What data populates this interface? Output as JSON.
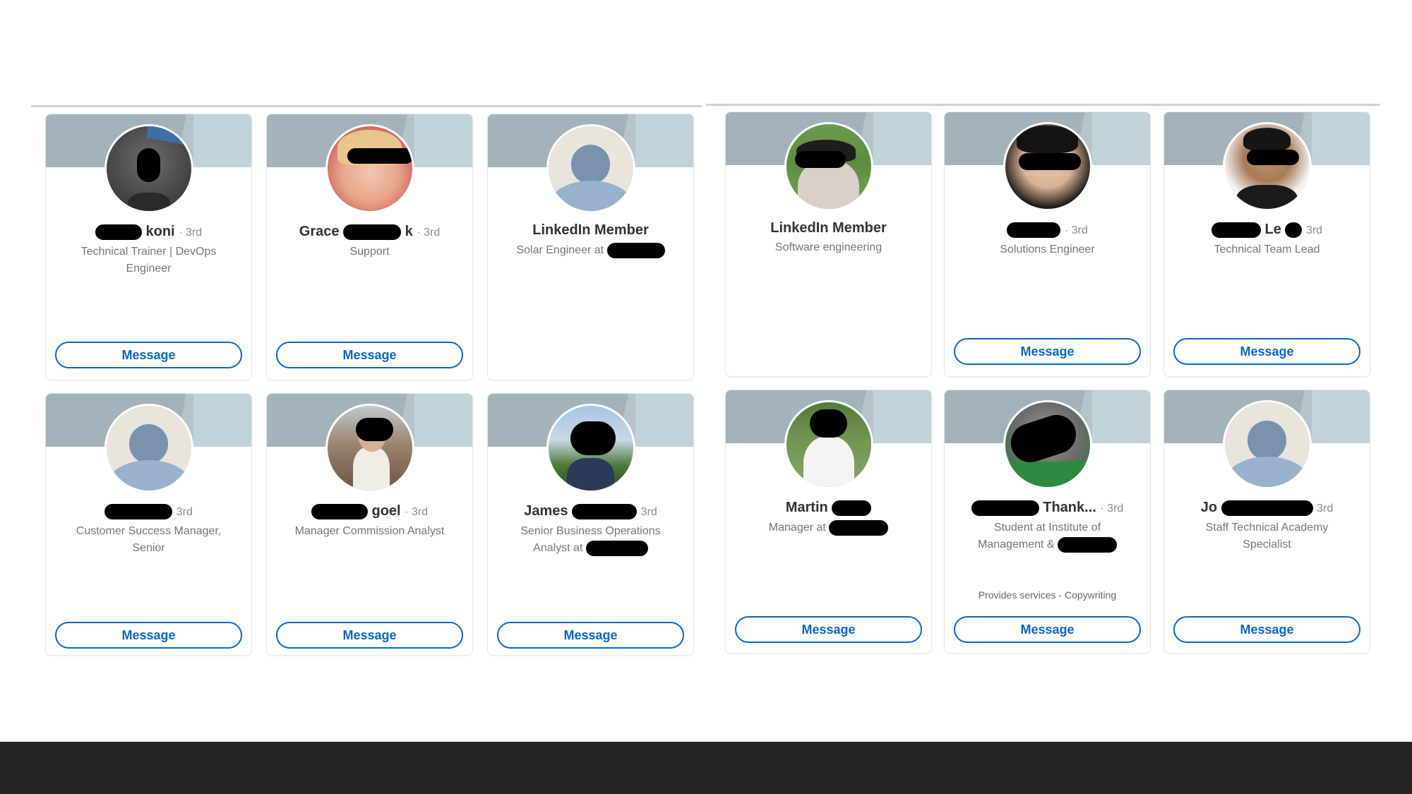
{
  "common": {
    "degree": "· 3rd",
    "degree_plain": "3rd",
    "message_label": "Message"
  },
  "cards": [
    {
      "name": "koni",
      "headline": "Technical Trainer | DevOps Engineer",
      "avatar": "photo-redacted"
    },
    {
      "name": "Grace",
      "name_suffix": "k",
      "headline": "Support",
      "avatar": "photo-redacted"
    },
    {
      "name": "LinkedIn Member",
      "headline": "Solar Engineer at",
      "avatar": "placeholder"
    },
    {
      "name": "LinkedIn Member",
      "headline": "Software engineering",
      "avatar": "photo-redacted"
    },
    {
      "name": "",
      "headline": "Solutions Engineer",
      "avatar": "photo-redacted"
    },
    {
      "name": "Le",
      "headline": "Technical Team Lead",
      "avatar": "photo-redacted"
    },
    {
      "name": "",
      "headline": "Customer Success Manager, Senior",
      "avatar": "placeholder"
    },
    {
      "name": "goel",
      "headline": "Manager Commission Analyst",
      "avatar": "photo-redacted"
    },
    {
      "name": "James",
      "headline": "Senior Business Operations Analyst at",
      "avatar": "photo-redacted"
    },
    {
      "name": "Martin",
      "headline": "Manager at",
      "avatar": "photo-redacted"
    },
    {
      "name": "Thank...",
      "headline": "Student at Institute of Management &",
      "services": "Provides services - Copywriting",
      "avatar": "photo-redacted"
    },
    {
      "name": "Jo",
      "headline": "Staff Technical Academy Specialist",
      "avatar": "placeholder"
    }
  ]
}
